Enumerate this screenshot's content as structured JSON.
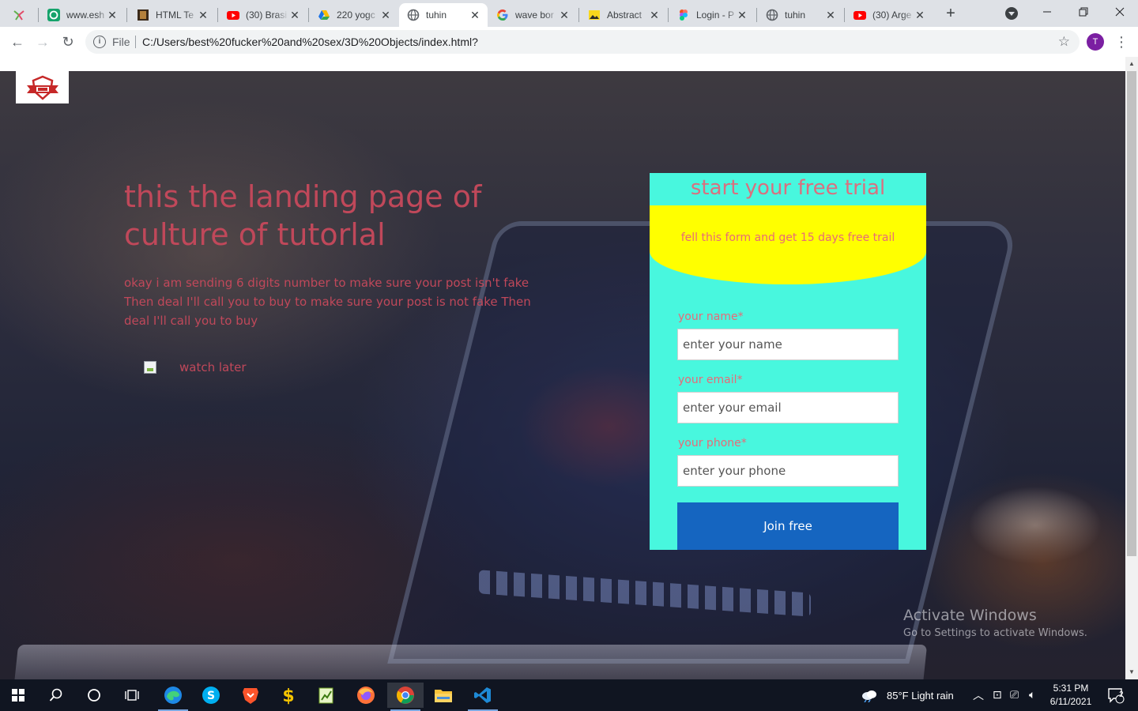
{
  "browser": {
    "tabs": [
      {
        "title": "",
        "icon": "ms-logo-icon",
        "active": false
      },
      {
        "title": "www.esh",
        "icon": "grammarly-icon",
        "active": false
      },
      {
        "title": "HTML Te",
        "icon": "book-icon",
        "active": false
      },
      {
        "title": "(30) Brasi",
        "icon": "youtube-icon",
        "active": false
      },
      {
        "title": "220 yogc",
        "icon": "google-drive-icon",
        "active": false
      },
      {
        "title": "tuhin",
        "icon": "globe-icon",
        "active": true
      },
      {
        "title": "wave bor",
        "icon": "google-icon",
        "active": false
      },
      {
        "title": "Abstract",
        "icon": "image-icon",
        "active": false
      },
      {
        "title": "Login - P",
        "icon": "figma-icon",
        "active": false
      },
      {
        "title": "tuhin",
        "icon": "globe-icon",
        "active": false
      },
      {
        "title": "(30) Arge",
        "icon": "youtube-icon",
        "active": false
      }
    ],
    "new_tab_symbol": "+",
    "address": {
      "scheme_label": "File",
      "url": "C:/Users/best%20fucker%20and%20sex/3D%20Objects/index.html?"
    },
    "profile_initial": "T",
    "colors": {
      "tabstrip": "#dee1e6",
      "profile": "#7b1fa2"
    }
  },
  "page": {
    "headline": "this the landing page of culture of tutorlal",
    "subtext": "okay i am sending 6 digits number to make sure your post isn't fake Then deal I'll call you to buy to make sure your post is not fake Then deal I'll call you to buy",
    "watch_later": "watch later",
    "form": {
      "title": "start your free trial",
      "banner": "fell this form and get 15 days free trail",
      "fields": [
        {
          "label": "your name*",
          "placeholder": "enter your name"
        },
        {
          "label": "your email*",
          "placeholder": "enter your email"
        },
        {
          "label": "your phone*",
          "placeholder": "enter your phone"
        }
      ],
      "submit_label": "Join free"
    },
    "colors": {
      "form_bg": "#48f7de",
      "banner_bg": "#ffff00",
      "button": "#1565c0",
      "text_accent": "#c0485a"
    }
  },
  "watermark": {
    "line1": "Activate Windows",
    "line2": "Go to Settings to activate Windows."
  },
  "taskbar": {
    "weather": "85°F  Light rain",
    "time": "5:31 PM",
    "date": "6/11/2021",
    "notification_count": "2"
  }
}
